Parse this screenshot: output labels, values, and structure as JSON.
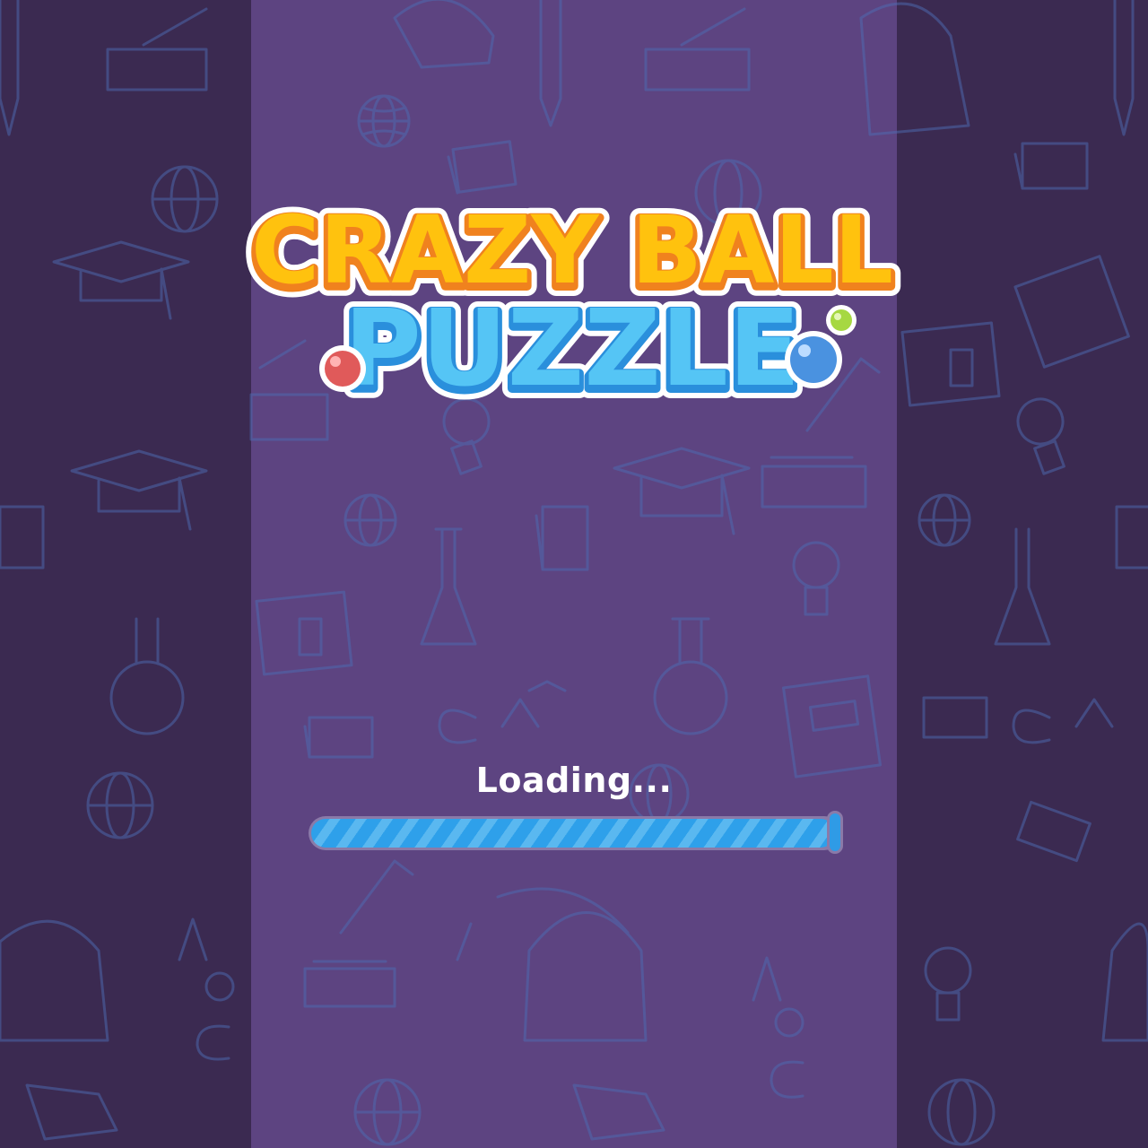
{
  "game": {
    "title_line1": "CRAZY BALL",
    "title_line2": "PUZZLE"
  },
  "loading": {
    "label": "Loading...",
    "progress": 1.0
  },
  "colors": {
    "background": "#5d4481",
    "side_panels": "#3b2a51",
    "title_yellow": "#ffc20e",
    "title_blue": "#55c5f5",
    "progress_fill": "#2ea0ea",
    "ball_red": "#e05a5a",
    "ball_blue": "#4a92e0",
    "ball_green": "#a6d842"
  }
}
